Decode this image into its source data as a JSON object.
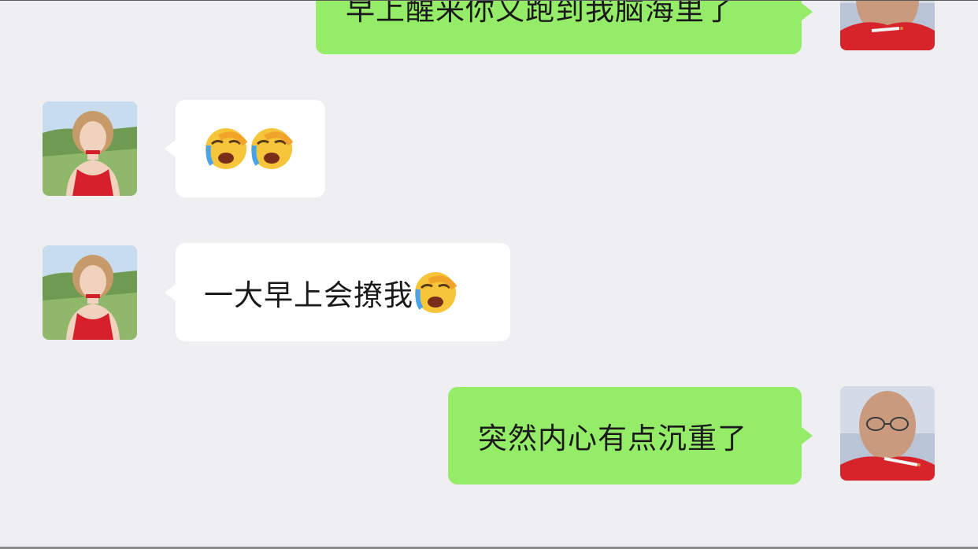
{
  "chat": {
    "messages": [
      {
        "side": "out",
        "text": "早上醒来你又跑到我脑海里了",
        "sender": "self"
      },
      {
        "side": "in",
        "text": "",
        "emoji": [
          "loudly-crying-face-emoji",
          "loudly-crying-face-emoji"
        ],
        "sender": "contact"
      },
      {
        "side": "in",
        "text": "一大早上会撩我",
        "emoji": [
          "loudly-crying-face-emoji"
        ],
        "sender": "contact"
      },
      {
        "side": "out",
        "text": "突然内心有点沉重了",
        "sender": "self"
      }
    ]
  },
  "colors": {
    "background": "#efeef1",
    "incoming_bubble": "#ffffff",
    "outgoing_bubble": "#95ec69",
    "text": "#1a1a1a"
  }
}
